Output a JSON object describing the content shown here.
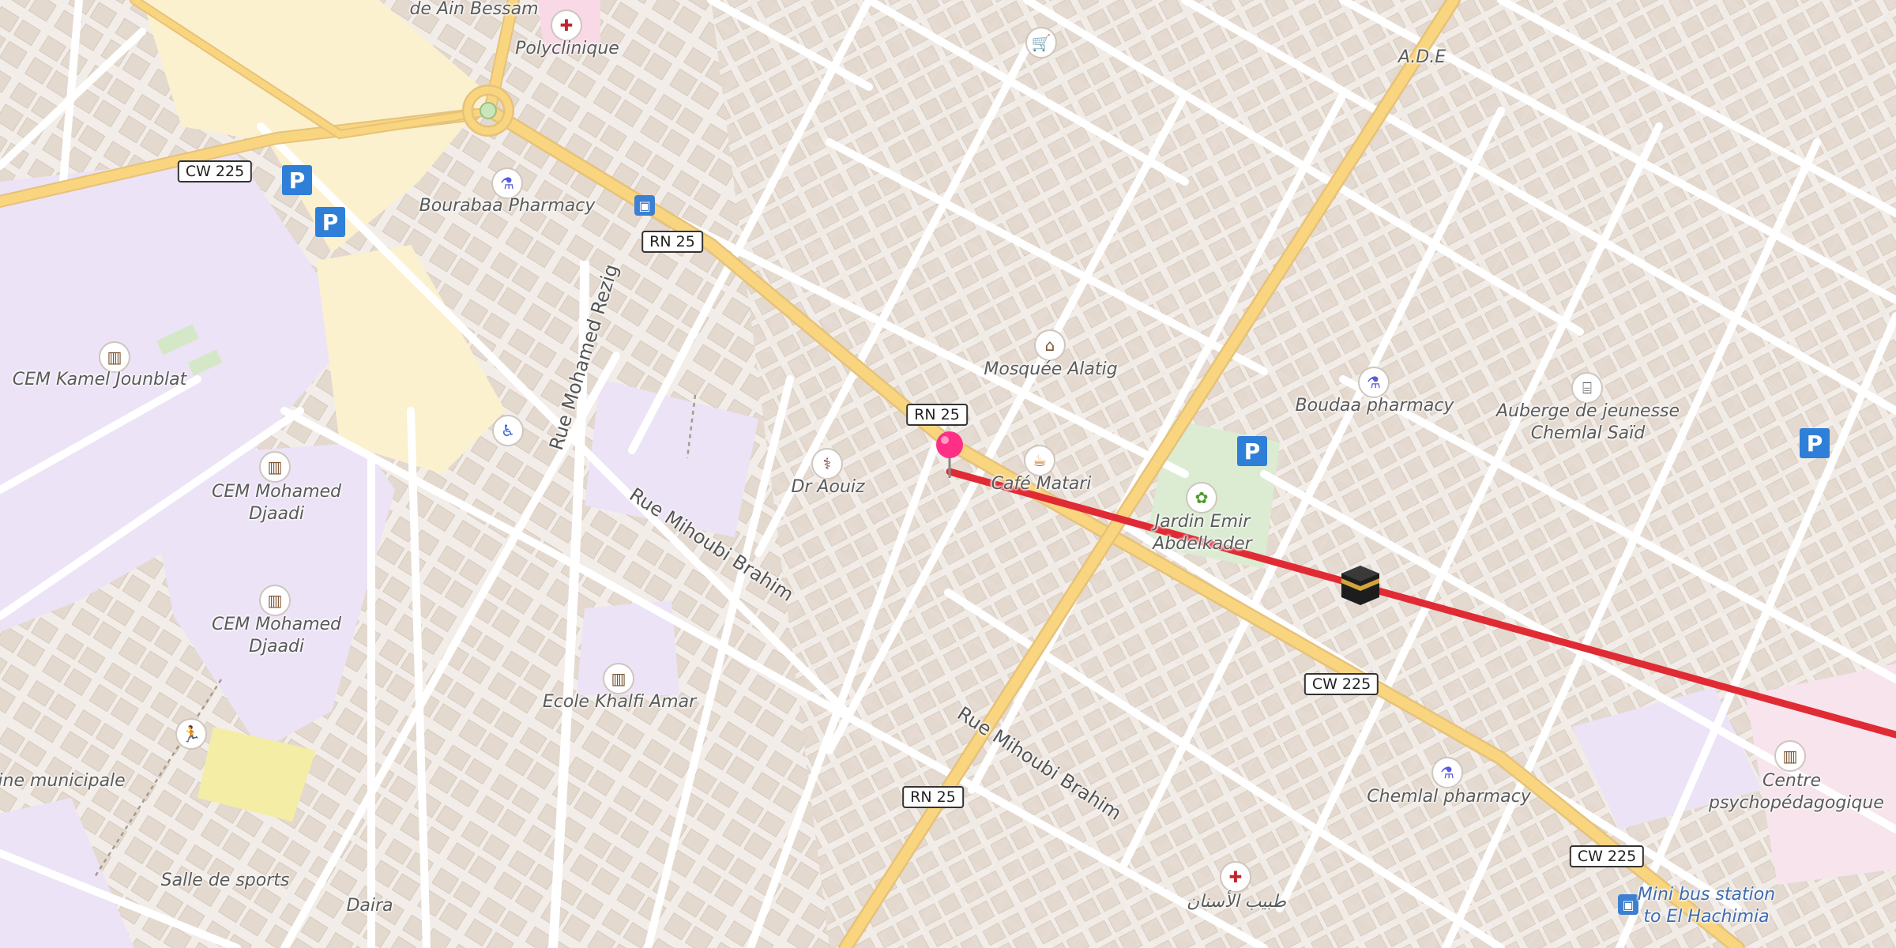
{
  "map": {
    "route_color": "#e02b35",
    "road_color": "#f9d580",
    "pin_color": "#ff2f86",
    "labels": {
      "top_cut": "de Ain Bessam",
      "polyclinique": "Polyclinique",
      "bourabaa": "Bourabaa Pharmacy",
      "cem_kamel": "CEM Kamel Jounblat",
      "cem_djaadi_1": "CEM Mohamed Djaadi",
      "cem_djaadi_2": "CEM Mohamed Djaadi",
      "piscine": "cine municipale",
      "salle": "Salle de sports",
      "daira": "Daira",
      "ecole": "Ecole Khalfi Amar",
      "dr_aouiz": "Dr Aouiz",
      "mosquee": "Mosquée Alatig",
      "cafe": "Café Matari",
      "jardin": "Jardin Emir Abdelkader",
      "ade": "A.D.E",
      "boudaa": "Boudaa pharmacy",
      "auberge": "Auberge de jeunesse Chemlal Saïd",
      "chemlal": "Chemlal pharmacy",
      "centre": "Centre psychopédagogique",
      "minibus": "Mini bus station to El Hachimia",
      "dentist": "طبيب الأسنان"
    },
    "streets": {
      "rezig": "Rue Mohamed Rezig",
      "mihoubi_1": "Rue Mihoubi Brahim",
      "mihoubi_2": "Rue Mihoubi Brahim"
    },
    "shields": {
      "cw225_a": "CW 225",
      "rn25_a": "RN 25",
      "rn25_b": "RN 25",
      "cw225_b": "CW 225",
      "rn25_c": "RN 25",
      "cw225_c": "CW 225"
    },
    "icons": {
      "hospital": "hospital-cross-icon",
      "pharmacy": "pharmacy-mortar-icon",
      "school": "school-icon",
      "mosque": "mosque-icon",
      "cafe": "cafe-cup-icon",
      "garden": "garden-icon",
      "parking": "P",
      "bus": "bus-stop-icon",
      "shop": "shopping-cart-icon",
      "hostel": "hostel-bed-icon",
      "doctor": "stethoscope-icon",
      "disabled": "wheelchair-icon",
      "sports": "runner-icon",
      "kaaba": "kaaba-icon"
    }
  }
}
